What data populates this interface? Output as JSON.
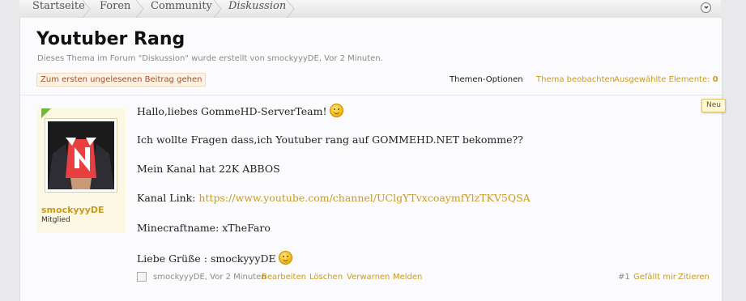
{
  "breadcrumb": {
    "items": [
      "Startseite",
      "Foren",
      "Community",
      "Diskussion"
    ]
  },
  "thread": {
    "title": "Youtuber Rang",
    "description": "Dieses Thema im Forum \"Diskussion\" wurde erstellt von smockyyyDE, Vor 2 Minuten.",
    "unread_button": "Zum ersten ungelesenen Beitrag gehen",
    "options": {
      "theme_options": "Themen-Optionen",
      "watch": "Thema beobachten",
      "selected": "Ausgewählte Elemente:",
      "selected_count": "0"
    }
  },
  "post": {
    "user": {
      "name": "smockyyyDE",
      "title": "Mitglied"
    },
    "new_badge": "Neu",
    "lines": {
      "greeting": "Hallo,liebes GommeHD-ServerTeam!",
      "question": "Ich wollte Fragen dass,ich Youtuber rang auf GOMMEHD.NET bekomme??",
      "channel": "Mein Kanal hat 22K ABBOS",
      "link_label": "Kanal Link:",
      "link_url": "https://www.youtube.com/channel/UClgYTvxcoaymfYlzTKV5QSA",
      "minecraft": "Minecraftname: xTheFaro",
      "regards": "Liebe Grüße : smockyyyDE"
    },
    "footer": {
      "meta": "smockyyyDE, Vor 2 Minuten",
      "edit": "Bearbeiten",
      "delete": "Löschen",
      "warn": "Verwarnen",
      "report": "Melden",
      "number": "#1",
      "like": "Gefällt mir",
      "quote": "Zitieren"
    }
  },
  "colors": {
    "accent": "#c99b1f",
    "online": "#6fba3b",
    "user_bg": "#fcf8e3"
  },
  "icons": [
    "chevron-separator-icon",
    "jump-menu-icon",
    "smiley-icon",
    "online-indicator-icon"
  ]
}
